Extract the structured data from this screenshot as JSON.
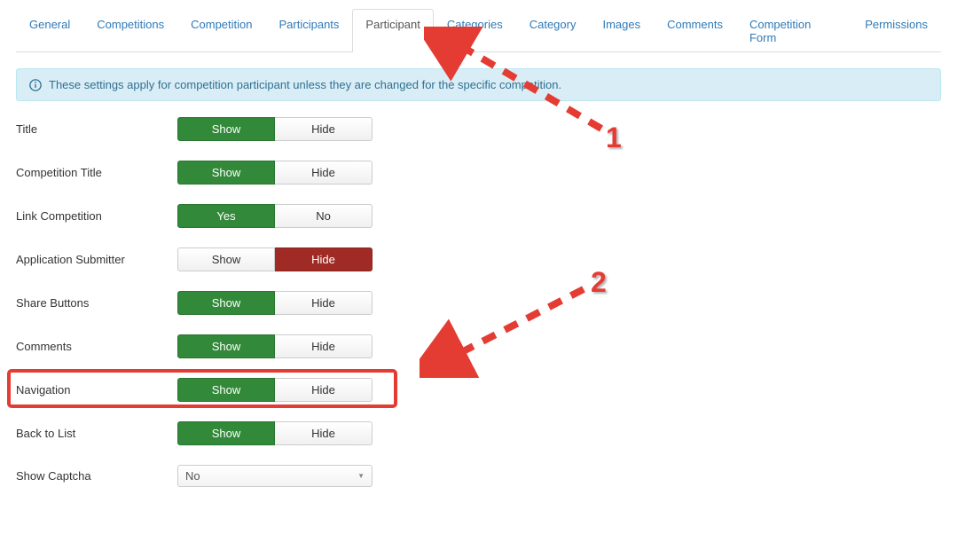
{
  "tabs": [
    {
      "label": "General",
      "active": false
    },
    {
      "label": "Competitions",
      "active": false
    },
    {
      "label": "Competition",
      "active": false
    },
    {
      "label": "Participants",
      "active": false
    },
    {
      "label": "Participant",
      "active": true
    },
    {
      "label": "Categories",
      "active": false
    },
    {
      "label": "Category",
      "active": false
    },
    {
      "label": "Images",
      "active": false
    },
    {
      "label": "Comments",
      "active": false
    },
    {
      "label": "Competition Form",
      "active": false
    },
    {
      "label": "Permissions",
      "active": false
    }
  ],
  "info_text": "These settings apply for competition participant unless they are changed for the specific competition.",
  "rows": [
    {
      "label": "Title",
      "type": "toggle",
      "left": "Show",
      "right": "Hide",
      "active": "left",
      "color": "green"
    },
    {
      "label": "Competition Title",
      "type": "toggle",
      "left": "Show",
      "right": "Hide",
      "active": "left",
      "color": "green"
    },
    {
      "label": "Link Competition",
      "type": "toggle",
      "left": "Yes",
      "right": "No",
      "active": "left",
      "color": "green"
    },
    {
      "label": "Application Submitter",
      "type": "toggle",
      "left": "Show",
      "right": "Hide",
      "active": "right",
      "color": "red"
    },
    {
      "label": "Share Buttons",
      "type": "toggle",
      "left": "Show",
      "right": "Hide",
      "active": "left",
      "color": "green"
    },
    {
      "label": "Comments",
      "type": "toggle",
      "left": "Show",
      "right": "Hide",
      "active": "left",
      "color": "green"
    },
    {
      "label": "Navigation",
      "type": "toggle",
      "left": "Show",
      "right": "Hide",
      "active": "left",
      "color": "green",
      "highlighted": true
    },
    {
      "label": "Back to List",
      "type": "toggle",
      "left": "Show",
      "right": "Hide",
      "active": "left",
      "color": "green"
    },
    {
      "label": "Show Captcha",
      "type": "select",
      "value": "No"
    }
  ],
  "annotations": {
    "label1": "1",
    "label2": "2"
  }
}
